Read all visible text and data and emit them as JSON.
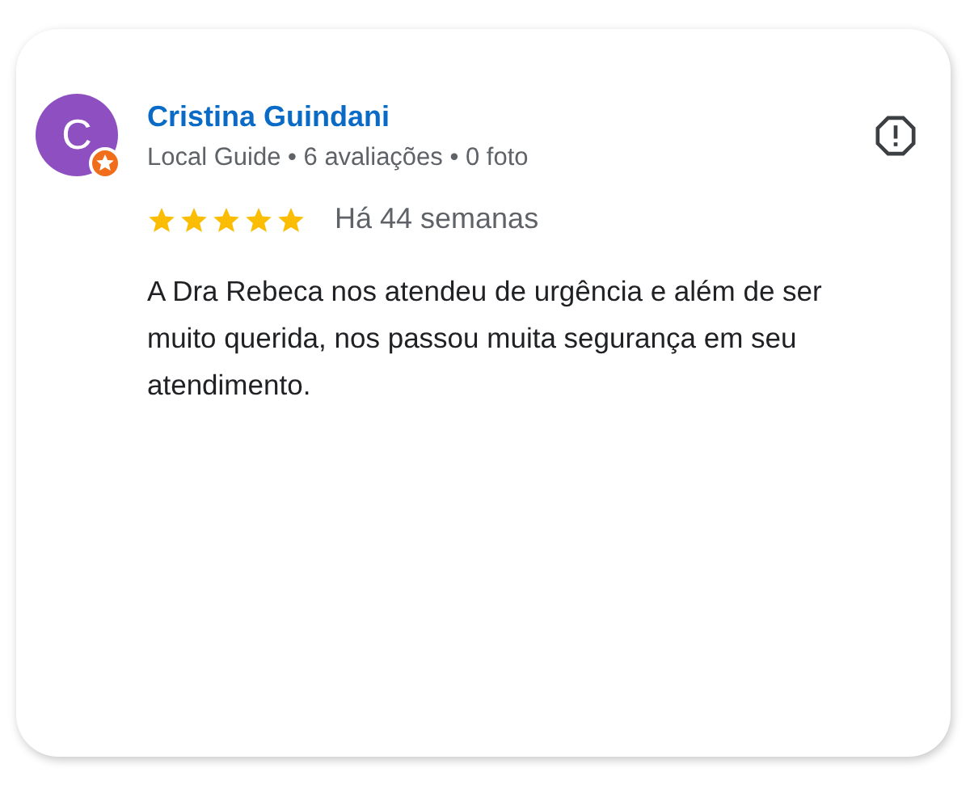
{
  "review": {
    "avatar_letter": "C",
    "author": "Cristina Guindani",
    "meta": "Local Guide • 6 avaliações • 0 foto",
    "stars": 5,
    "time": "Há 44 semanas",
    "text": "A Dra Rebeca nos atendeu de urgência e além de ser muito querida, nos passou muita segurança em seu atendimento."
  }
}
